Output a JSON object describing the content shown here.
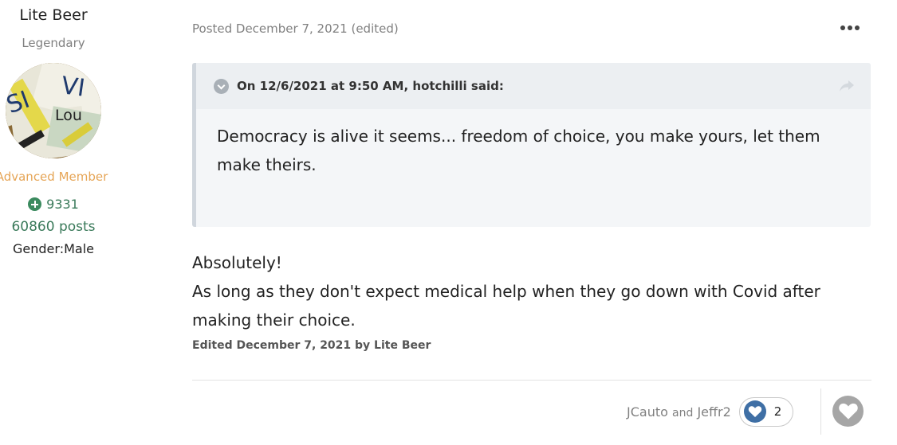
{
  "author": {
    "name": "Lite Beer",
    "title": "Legendary",
    "group": "Advanced Member",
    "reputation": "9331",
    "posts": "60860 posts",
    "gender": "Gender:Male",
    "avatar_text": [
      "SI",
      "VI",
      "Lou"
    ]
  },
  "post": {
    "meta": "Posted December 7, 2021 (edited)",
    "quote": {
      "citation": "On 12/6/2021 at 9:50 AM, hotchilli said:",
      "text": "Democracy is alive it seems... freedom of choice, you make yours, let them make theirs."
    },
    "body_lines": [
      "Absolutely!",
      "As long as they don't expect medical help when they go down with Covid after making their choice."
    ],
    "edited_note": "Edited December 7, 2021 by Lite Beer"
  },
  "reactions": {
    "user1": "JCauto",
    "and": "and",
    "user2": "Jeffr2",
    "count": "2"
  },
  "icons": {
    "more": "ellipsis-icon",
    "toggle": "chevron-down-icon",
    "share": "share-arrow-icon",
    "react": "heart-icon",
    "like": "heart-icon"
  },
  "colors": {
    "group": "#e6a556",
    "reputation": "#3a7a5a",
    "react_heart": "#3f6fa5",
    "like_button": "#a6a6a6"
  }
}
